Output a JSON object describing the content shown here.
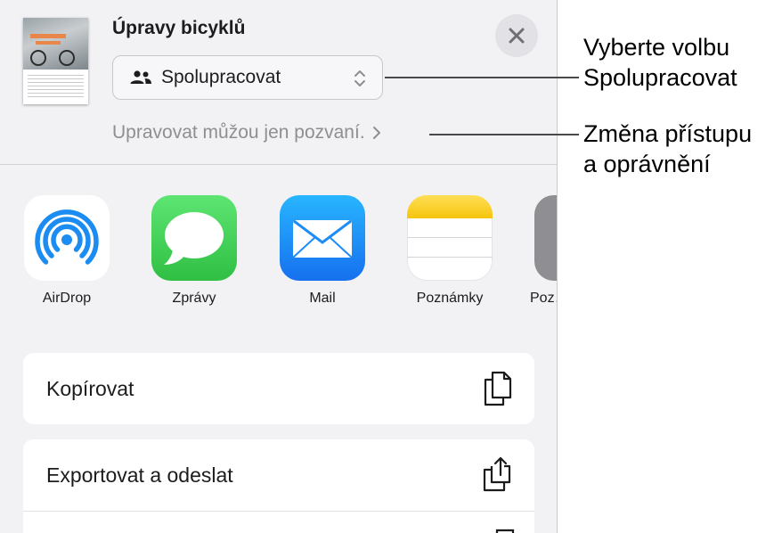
{
  "sheet": {
    "title": "Úpravy bicyklů",
    "collaboration": {
      "selected": "Spolupracovat"
    },
    "access_link": "Upravovat můžou jen pozvaní."
  },
  "apps": [
    {
      "name": "AirDrop",
      "icon": "airdrop-icon"
    },
    {
      "name": "Zprávy",
      "icon": "messages-icon"
    },
    {
      "name": "Mail",
      "icon": "mail-icon"
    },
    {
      "name": "Poznámky",
      "icon": "notes-icon"
    },
    {
      "name": "Poz…",
      "icon": "reminders-icon"
    }
  ],
  "actions": [
    {
      "label": "Kopírovat",
      "icon": "copy-icon"
    },
    {
      "label": "Exportovat a odeslat",
      "icon": "share-icon"
    }
  ],
  "callouts": {
    "collaborate": [
      "Vyberte volbu",
      "Spolupracovat"
    ],
    "access": [
      "Změna přístupu",
      "a oprávnění"
    ]
  },
  "colors": {
    "sheet_bg": "#f2f2f4",
    "messages_green": "#34c759",
    "mail_blue": "#1e8cf6",
    "airdrop_blue": "#1a8cf2",
    "notes_yellow": "#ffd52e"
  }
}
